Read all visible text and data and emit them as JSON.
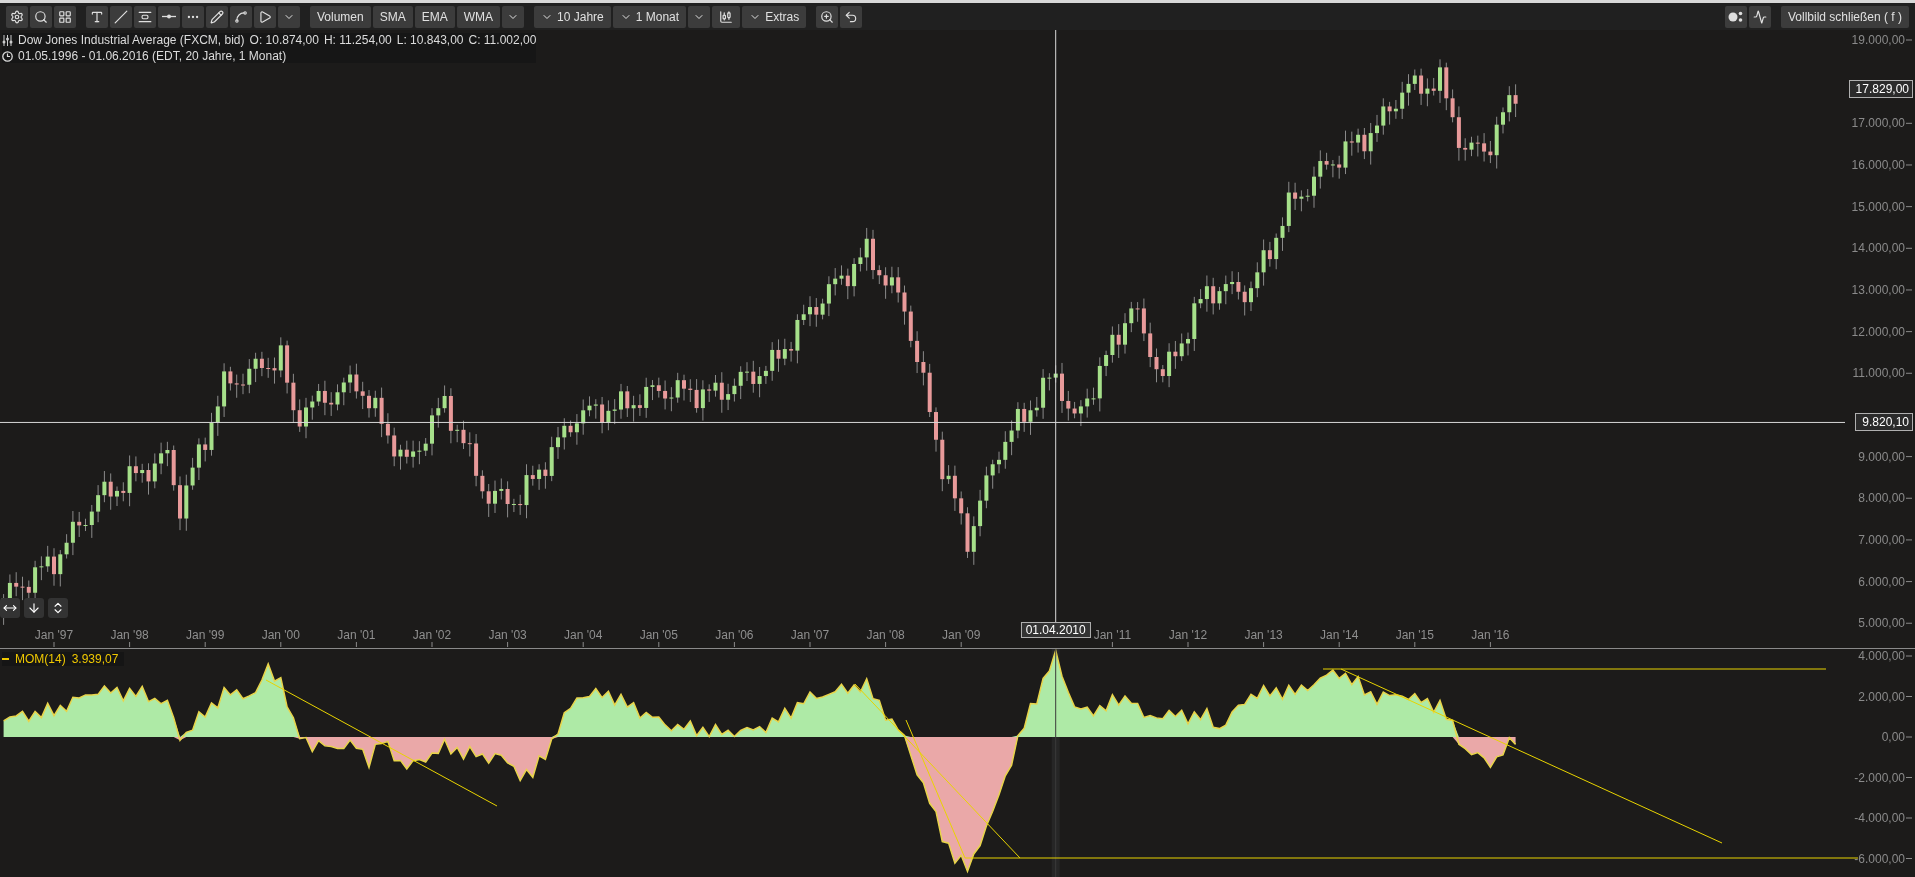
{
  "toolbar": {
    "indicator_buttons": [
      "Volumen",
      "SMA",
      "EMA",
      "WMA"
    ],
    "range_dropdowns": [
      {
        "label": "10 Jahre"
      },
      {
        "label": "1 Monat"
      }
    ],
    "extras_dropdown": "Extras",
    "fullscreen_button": "Vollbild schließen ( f )"
  },
  "legend": {
    "title": "Dow Jones Industrial Average (FXCM, bid)",
    "ohlc": [
      "O: 10.874,00",
      "H: 11.254,00",
      "L: 10.843,00",
      "C: 11.002,00"
    ],
    "range": "01.05.1996 - 01.06.2016 (EDT, 20 Jahre, 1 Monat)"
  },
  "price_axis": {
    "ticks": [
      "19.000,00",
      "17.000,00",
      "16.000,00",
      "15.000,00",
      "14.000,00",
      "13.000,00",
      "12.000,00",
      "11.000,00",
      "9.000,00",
      "8.000,00",
      "7.000,00",
      "6.000,00",
      "5.000,00"
    ],
    "last_price": "17.829,00",
    "crosshair_price": "9.820,10"
  },
  "time_axis": {
    "labels": [
      "Jan '97",
      "Jan '98",
      "Jan '99",
      "Jan '00",
      "Jan '01",
      "Jan '02",
      "Jan '03",
      "Jan '04",
      "Jan '05",
      "Jan '06",
      "Jan '07",
      "Jan '08",
      "Jan '09",
      "Jan '11",
      "Jan '12",
      "Jan '13",
      "Jan '14",
      "Jan '15",
      "Jan '16"
    ],
    "crosshair_date": "01.04.2010"
  },
  "indicator": {
    "name": "MOM(14)",
    "value": "3.939,07",
    "ticks": [
      "4.000,00",
      "2.000,00",
      "0,00",
      "-2.000,00",
      "-4.000,00",
      "-6.000,00"
    ]
  }
}
